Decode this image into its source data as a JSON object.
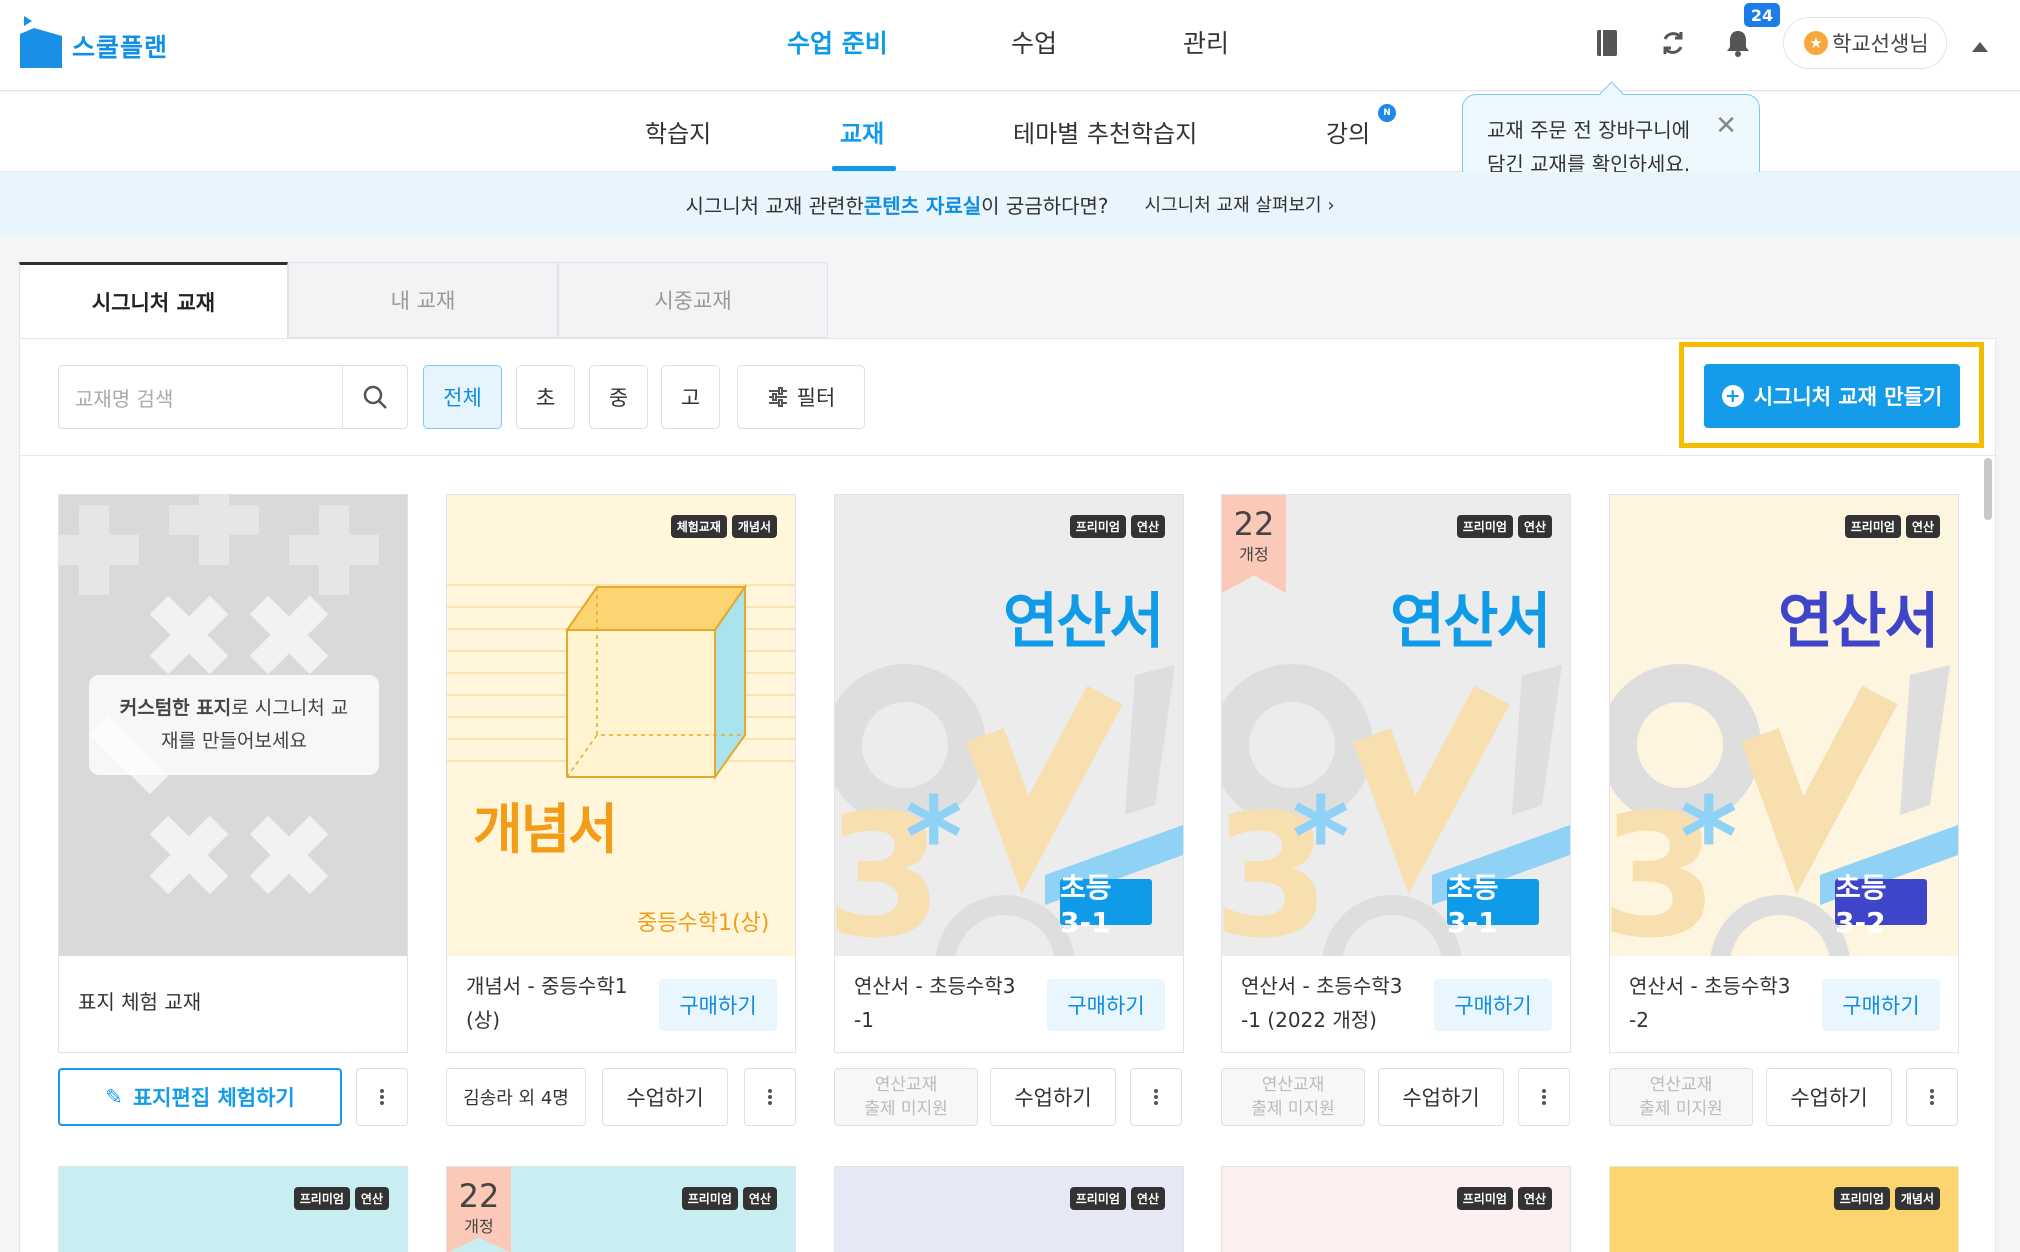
{
  "app": {
    "name": "스쿨플랜"
  },
  "main_nav": [
    {
      "label": "수업 준비",
      "active": true
    },
    {
      "label": "수업",
      "active": false
    },
    {
      "label": "관리",
      "active": false
    }
  ],
  "header": {
    "notification_count": "24",
    "user_label": "학교선생님"
  },
  "sub_nav": [
    {
      "label": "학습지"
    },
    {
      "label": "교재"
    },
    {
      "label": "테마별 추천학습지"
    },
    {
      "label": "강의"
    }
  ],
  "new_badge": "N",
  "tooltip": {
    "line1": "교재 주문 전 장바구니에",
    "line2": "담긴 교재를 확인하세요."
  },
  "banner": {
    "pre": "시그니처 교재 관련한 ",
    "highlight": "콘텐츠 자료실",
    "post": "이 궁금하다면?",
    "link": "시그니처 교재 살펴보기"
  },
  "tabs": [
    {
      "label": "시그니처 교재"
    },
    {
      "label": "내 교재"
    },
    {
      "label": "시중교재"
    }
  ],
  "search": {
    "placeholder": "교재명 검색"
  },
  "filters": [
    {
      "label": "전체"
    },
    {
      "label": "초"
    },
    {
      "label": "중"
    },
    {
      "label": "고"
    }
  ],
  "filter_button": "필터",
  "create_button": "시그니처 교재 만들기",
  "cards": [
    {
      "hint_bold": "커스텀한 표지",
      "hint_rest": "로 시그니처 교",
      "hint_line2": "재를 만들어보세요",
      "title": "표지 체험 교재",
      "edit_button": "표지편집 체험하기"
    },
    {
      "tags": [
        "체험교재",
        "개념서"
      ],
      "cover_title": "개념서",
      "cover_sub": "중등수학1(상)",
      "title_l1": "개념서 - 중등수학1",
      "title_l2": "(상)",
      "buy": "구매하기",
      "people": "김송라 외 4명",
      "class_btn": "수업하기"
    },
    {
      "tags": [
        "프리미엄",
        "연산"
      ],
      "cover_title": "연산서",
      "grade": "초등 3-1",
      "title_l1": "연산서 - 초등수학3",
      "title_l2": "-1",
      "buy": "구매하기",
      "disabled_l1": "연산교재",
      "disabled_l2": "출제 미지원",
      "class_btn": "수업하기"
    },
    {
      "tags": [
        "프리미엄",
        "연산"
      ],
      "revision": {
        "num": "22",
        "text": "개정"
      },
      "cover_title": "연산서",
      "grade": "초등 3-1",
      "title_l1": "연산서 - 초등수학3",
      "title_l2": "-1 (2022 개정)",
      "buy": "구매하기",
      "disabled_l1": "연산교재",
      "disabled_l2": "출제 미지원",
      "class_btn": "수업하기"
    },
    {
      "tags": [
        "프리미엄",
        "연산"
      ],
      "cover_title": "연산서",
      "grade": "초등 3-2",
      "title_l1": "연산서 - 초등수학3",
      "title_l2": "-2",
      "buy": "구매하기",
      "disabled_l1": "연산교재",
      "disabled_l2": "출제 미지원",
      "class_btn": "수업하기"
    }
  ],
  "row2": [
    {
      "tags": [
        "프리미엄",
        "연산"
      ]
    },
    {
      "tags": [
        "프리미엄",
        "연산"
      ],
      "revision": {
        "num": "22",
        "text": "개정"
      }
    },
    {
      "tags": [
        "프리미엄",
        "연산"
      ]
    },
    {
      "tags": [
        "프리미엄",
        "연산"
      ]
    },
    {
      "tags": [
        "프리미엄",
        "개념서"
      ]
    }
  ],
  "colors": {
    "accent": "#149bea",
    "highlight_box": "#f5bd00",
    "grade_blue": "#0f9be8",
    "grade_navy": "#3f45c8"
  }
}
